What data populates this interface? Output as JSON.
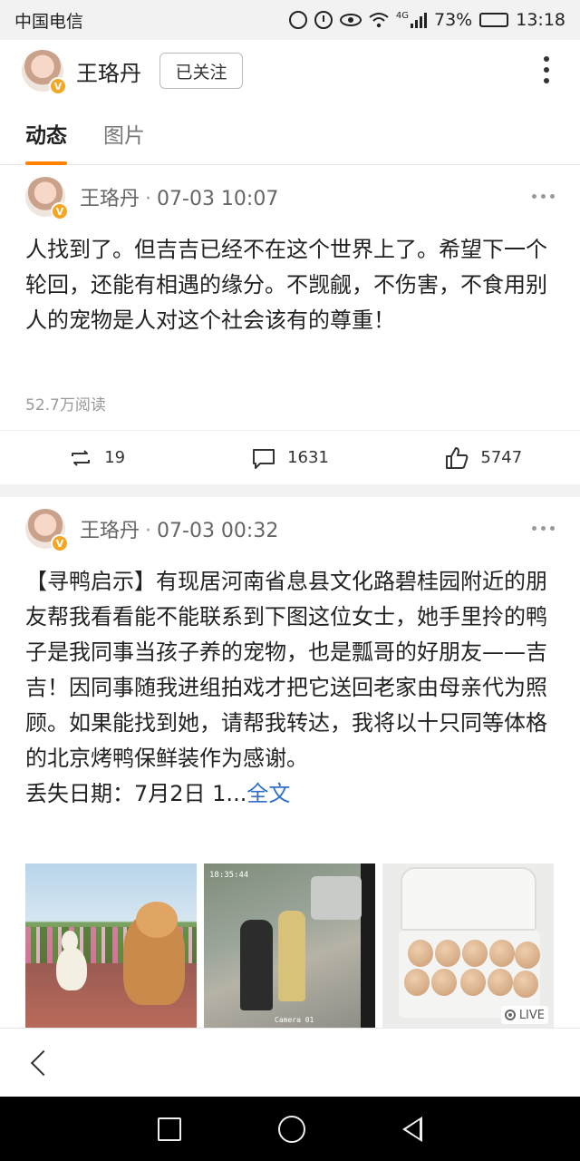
{
  "status_bar": {
    "carrier": "中国电信",
    "network": "4G",
    "battery": "73%",
    "time": "13:18"
  },
  "header": {
    "name": "王珞丹",
    "follow_label": "已关注"
  },
  "tabs": [
    {
      "label": "动态",
      "active": true
    },
    {
      "label": "图片",
      "active": false
    }
  ],
  "posts": [
    {
      "author": "王珞丹",
      "time": "07-03 10:07",
      "text": "人找到了。但吉吉已经不在这个世界上了。希望下一个轮回，还能有相遇的缘分。不觊觎，不伤害，不食用别人的宠物是人对这个社会该有的尊重！",
      "read_count": "52.7万阅读",
      "reposts": "19",
      "comments": "1631",
      "likes": "5747"
    },
    {
      "author": "王珞丹",
      "time": "07-03 00:32",
      "text": "【寻鸭启示】有现居河南省息县文化路碧桂园附近的朋友帮我看看能不能联系到下图这位女士，她手里拎的鸭子是我同事当孩子养的宠物，也是瓢哥的好朋友——吉吉！因同事随我进组拍戏才把它送回老家由母亲代为照顾。如果能找到她，请帮我转达，我将以十只同等体格的北京烤鸭保鲜装作为感谢。",
      "text_tail": "丢失日期：7月2日 1...",
      "full_text_link": "全文",
      "images": [
        {
          "name": "duck-dog-photo"
        },
        {
          "name": "cctv-photo",
          "timestamp": "18:35:44",
          "camera": "Camera 01"
        },
        {
          "name": "eggs-photo",
          "live_label": "LIVE"
        }
      ]
    }
  ],
  "colors": {
    "accent": "#ff8200",
    "link": "#3070c8",
    "badge": "#f5a623"
  }
}
